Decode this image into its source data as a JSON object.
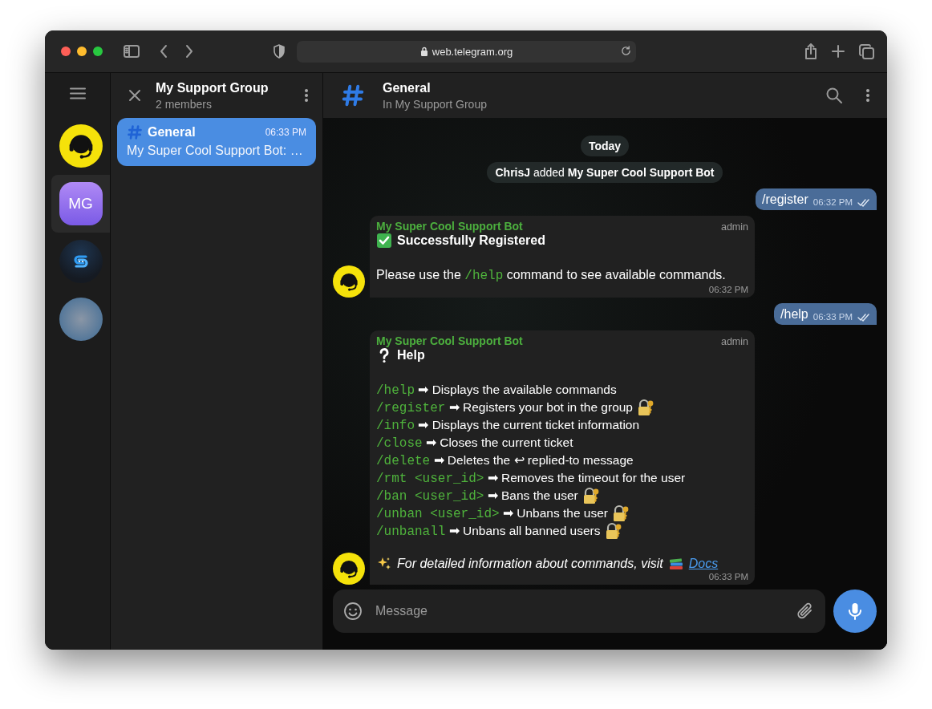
{
  "browser": {
    "url": "web.telegram.org"
  },
  "folders": [
    {
      "kind": "headset",
      "selected": false
    },
    {
      "kind": "initials",
      "initials": "MG",
      "selected": true
    },
    {
      "kind": "logo",
      "selected": false
    },
    {
      "kind": "photo",
      "selected": false
    }
  ],
  "group": {
    "title": "My Support Group",
    "subtitle": "2 members"
  },
  "topics": [
    {
      "title": "General",
      "time": "06:33 PM",
      "preview": "My Super Cool Support Bot: …",
      "selected": true
    }
  ],
  "chat": {
    "title": "General",
    "subtitle": "In My Support Group"
  },
  "messages": [
    {
      "kind": "date",
      "text": "Today"
    },
    {
      "kind": "service",
      "text": "**ChrisJ** added **My Super Cool Support Bot**"
    },
    {
      "kind": "outgoing",
      "text": "/register",
      "time": "06:32 PM",
      "read": true
    },
    {
      "kind": "incoming",
      "sender": "My Super Cool Support Bot",
      "badge": "admin",
      "time": "06:32 PM",
      "title": {
        "text": "Successfully Registered"
      },
      "blocks": [
        {
          "kind": "paragraph",
          "parts": [
            {
              "kind": "text",
              "text": "Please use the "
            },
            {
              "kind": "code",
              "text": "/help"
            },
            {
              "kind": "text",
              "text": " command to see available commands."
            }
          ]
        }
      ]
    },
    {
      "kind": "outgoing",
      "text": "/help",
      "time": "06:33 PM",
      "read": true
    },
    {
      "kind": "incoming",
      "sender": "My Super Cool Support Bot",
      "badge": "admin",
      "time": "06:33 PM",
      "title": {
        "text": "Help"
      },
      "blocks": [
        {
          "kind": "commands",
          "items": [
            {
              "command": "/help",
              "description": "➡ Displays the available commands",
              "locked": false
            },
            {
              "command": "/register",
              "description": "➡ Registers your bot in the group",
              "locked": true
            },
            {
              "command": "/info",
              "description": "➡ Displays the current ticket information",
              "locked": false
            },
            {
              "command": "/close",
              "description": "➡ Closes the current ticket",
              "locked": false
            },
            {
              "command": "/delete",
              "description": "➡ Deletes the ↩ replied-to message",
              "locked": false
            },
            {
              "command": "/rmt <user_id>",
              "description": "➡ Removes the timeout for the user",
              "locked": false
            },
            {
              "command": "/ban <user_id>",
              "description": "➡ Bans the user",
              "locked": true
            },
            {
              "command": "/unban <user_id>",
              "description": "➡ Unbans the user",
              "locked": true
            },
            {
              "command": "/unbanall",
              "description": "➡ Unbans all banned users",
              "locked": true
            }
          ]
        },
        {
          "kind": "note",
          "text": "For detailed information about commands, visit",
          "link": "Docs"
        }
      ]
    }
  ],
  "composer": {
    "placeholder": "Message"
  }
}
